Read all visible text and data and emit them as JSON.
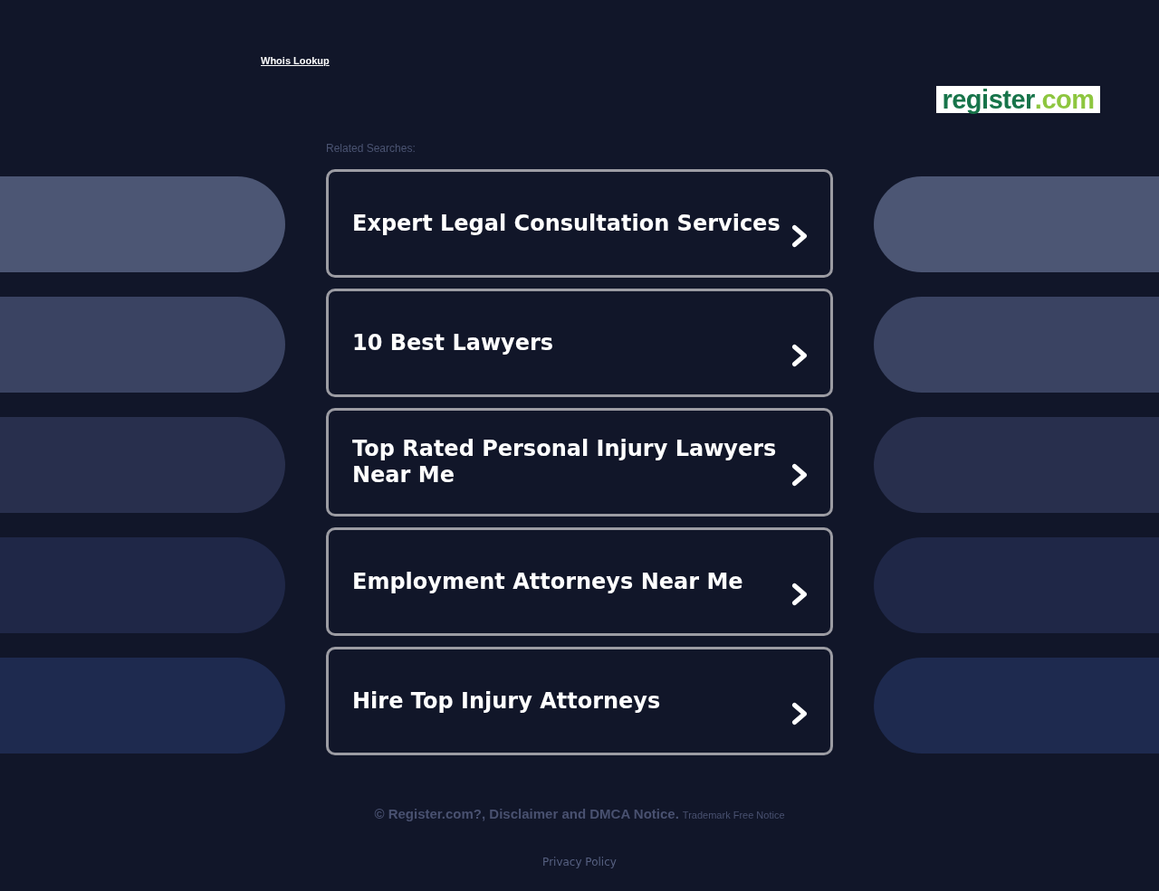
{
  "header": {
    "whois_link": "Whois Lookup",
    "logo": {
      "main": "register",
      "suffix": ".com"
    }
  },
  "related": {
    "heading": "Related Searches:",
    "links": [
      {
        "label": "Expert Legal Consultation Services"
      },
      {
        "label": "10 Best Lawyers"
      },
      {
        "label": "Top Rated Personal Injury Lawyers Near Me"
      },
      {
        "label": "Employment Attorneys Near Me"
      },
      {
        "label": "Hire Top Injury Attorneys"
      }
    ]
  },
  "footer": {
    "copyright": "© Register.com?, Disclaimer and DMCA Notice.",
    "trademark_link": "Trademark Free Notice",
    "privacy_link": "Privacy Policy"
  }
}
